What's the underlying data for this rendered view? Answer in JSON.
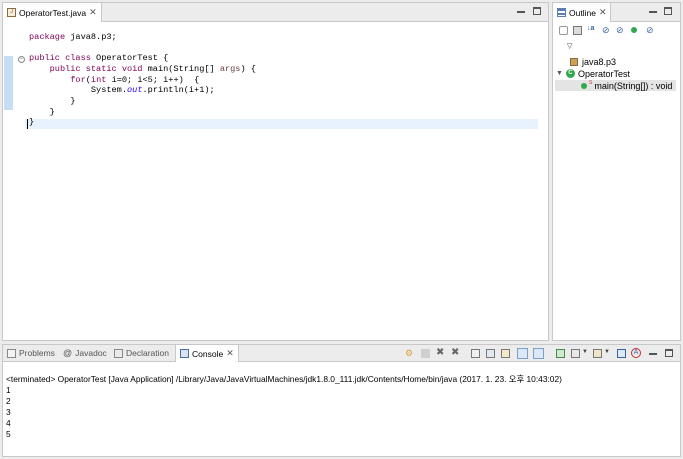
{
  "editor": {
    "tab_label": "OperatorTest.java",
    "lines": {
      "l1": "package java8.p3;",
      "l2_kw": "public class",
      "l2_rest": " OperatorTest {",
      "l3_kw": "public static void",
      "l3_rest": " main(String[] ",
      "l3_arg": "args",
      "l3_end": ") {",
      "l4_kw": "for",
      "l4_a": "(",
      "l4_kw2": "int",
      "l4_rest": " i=0; i<5; i++)  {",
      "l5_a": "System.",
      "l5_out": "out",
      "l5_rest": ".println(i+1);",
      "l6": "}",
      "l7": "}",
      "l8": "}"
    }
  },
  "outline": {
    "tab_label": "Outline",
    "items": [
      {
        "label": "java8.p3"
      },
      {
        "label": "OperatorTest"
      },
      {
        "label": "main(String[]) : void",
        "badge": "S"
      }
    ]
  },
  "bottom": {
    "tabs": [
      {
        "label": "Problems"
      },
      {
        "label": "Javadoc"
      },
      {
        "label": "Declaration"
      },
      {
        "label": "Console"
      }
    ],
    "console": {
      "header": "<terminated> OperatorTest [Java Application] /Library/Java/JavaVirtualMachines/jdk1.8.0_111.jdk/Contents/Home/bin/java (2017. 1. 23. 오후 10:43:02)",
      "output": [
        "1",
        "2",
        "3",
        "4",
        "5"
      ]
    }
  },
  "colors": {
    "keyword": "#7f0055",
    "field": "#2a00ff",
    "current_line": "#e8f2fe",
    "ruler_mark": "#c7dcf5"
  }
}
